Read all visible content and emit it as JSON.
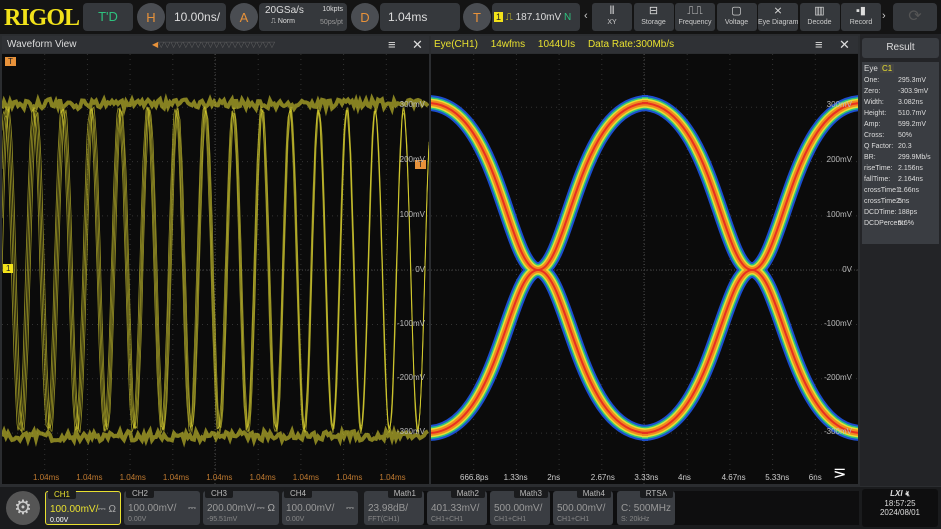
{
  "topbar": {
    "logo": "RIGOL",
    "run_state": "T'D",
    "horizontal": {
      "icon": "H",
      "value": "10.00ns/"
    },
    "acquire": {
      "icon": "A",
      "sample_rate": "20GSa/s",
      "mode": "Norm",
      "memory_depth": "10kpts",
      "resolution": "50ps/pt"
    },
    "delay": {
      "icon": "D",
      "value": "1.04ms"
    },
    "trigger": {
      "icon": "T",
      "source": "1",
      "level": "187.10mV",
      "sweep": "N"
    },
    "tools": [
      {
        "label": "XY",
        "icon": "xy-icon"
      },
      {
        "label": "Storage",
        "icon": "storage-icon"
      },
      {
        "label": "Frequency",
        "icon": "frequency-icon"
      },
      {
        "label": "Voltage",
        "icon": "voltage-icon"
      },
      {
        "label": "Eye Diagram",
        "icon": "eye-diagram-icon"
      },
      {
        "label": "Decode",
        "icon": "decode-icon"
      },
      {
        "label": "Record",
        "icon": "record-icon"
      }
    ]
  },
  "waveform": {
    "title": "Waveform View",
    "ch_marker": "1",
    "trig_marker": "T",
    "y_labels": [
      "300mV",
      "200mV",
      "100mV",
      "0V",
      "-100mV",
      "-200mV",
      "-300mV"
    ],
    "x_labels": [
      "1.04ms",
      "1.04ms",
      "1.04ms",
      "1.04ms",
      "1.04ms",
      "1.04ms",
      "1.04ms",
      "1.04ms",
      "1.04ms"
    ],
    "trace_color": "#d8d030"
  },
  "eye": {
    "title": "Eye(CH1)",
    "wfms": "14wfms",
    "uis": "1044UIs",
    "data_rate": "Data Rate:300Mb/s",
    "y_labels": [
      "300mV",
      "200mV",
      "100mV",
      "0V",
      "-100mV",
      "-200mV",
      "-300mV"
    ],
    "x_labels": [
      "666.8ps",
      "1.33ns",
      "2ns",
      "2.67ns",
      "3.33ns",
      "4ns",
      "4.67ns",
      "5.33ns",
      "6ns"
    ]
  },
  "result": {
    "title": "Result",
    "tab": "Eye",
    "tab_src": "C1",
    "rows": [
      [
        "One:",
        "295.3mV"
      ],
      [
        "Zero:",
        "-303.9mV"
      ],
      [
        "Width:",
        "3.082ns"
      ],
      [
        "Height:",
        "510.7mV"
      ],
      [
        "Amp:",
        "599.2mV"
      ],
      [
        "Cross:",
        "50%"
      ],
      [
        "Q Factor:",
        "20.3"
      ],
      [
        "BR:",
        "299.9Mb/s"
      ],
      [
        "riseTime:",
        "2.156ns"
      ],
      [
        "fallTime:",
        "2.164ns"
      ],
      [
        "crossTime1:",
        "1.66ns"
      ],
      [
        "crossTime2:",
        "5ns"
      ],
      [
        "DCDTime:",
        "188ps"
      ],
      [
        "DCDPercent:",
        "5.6%"
      ]
    ]
  },
  "channels": [
    {
      "name": "CH1",
      "scale": "100.00mV/",
      "offset": "0.00V",
      "coupling": "⎓ Ω",
      "color": "#e8e030",
      "active": true
    },
    {
      "name": "CH2",
      "scale": "100.00mV/",
      "offset": "0.00V",
      "coupling": "⎓"
    },
    {
      "name": "CH3",
      "scale": "200.00mV/",
      "offset": "-95.51mV",
      "coupling": "⎓ Ω"
    },
    {
      "name": "CH4",
      "scale": "100.00mV/",
      "offset": "0.00V",
      "coupling": "⎓"
    }
  ],
  "maths": [
    {
      "name": "Math1",
      "scale": "23.98dB/",
      "src": "FFT(CH1)"
    },
    {
      "name": "Math2",
      "scale": "401.33mV/",
      "src": "CH1+CH1"
    },
    {
      "name": "Math3",
      "scale": "500.00mV/",
      "src": "CH1+CH1"
    },
    {
      "name": "Math4",
      "scale": "500.00mV/",
      "src": "CH1+CH1"
    }
  ],
  "rtsa": {
    "name": "RTSA",
    "center": "C: 500MHz",
    "span": "S: 20kHz"
  },
  "status": {
    "lxi": "LXI",
    "time": "18:57:25",
    "date": "2024/08/01"
  }
}
